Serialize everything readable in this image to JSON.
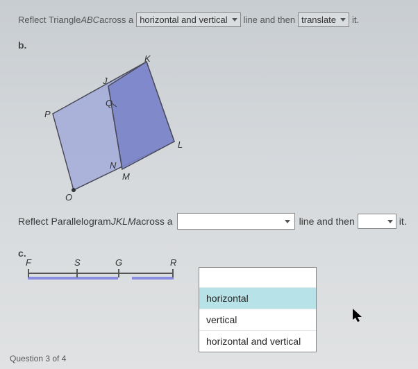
{
  "question_a": {
    "prefix": "Reflect Triangle ",
    "shape": "ABC",
    "mid1": " across a ",
    "select1_value": "horizontal and vertical",
    "mid2": " line and then ",
    "select2_value": "translate",
    "suffix": " it."
  },
  "label_b": "b.",
  "figure": {
    "K": "K",
    "J": "J",
    "Q": "Q",
    "P": "P",
    "L": "L",
    "N": "N",
    "M": "M",
    "O": "O"
  },
  "question_b": {
    "prefix": "Reflect Parallelogram ",
    "shape": "JKLM",
    "mid1": " across a ",
    "mid2": " line and then ",
    "suffix": " it."
  },
  "dropdown": {
    "options": [
      "horizontal",
      "vertical",
      "horizontal and vertical"
    ]
  },
  "label_c": "c.",
  "ruler": {
    "F": "F",
    "S": "S",
    "G": "G",
    "R": "R"
  },
  "footer": "Question 3 of 4"
}
